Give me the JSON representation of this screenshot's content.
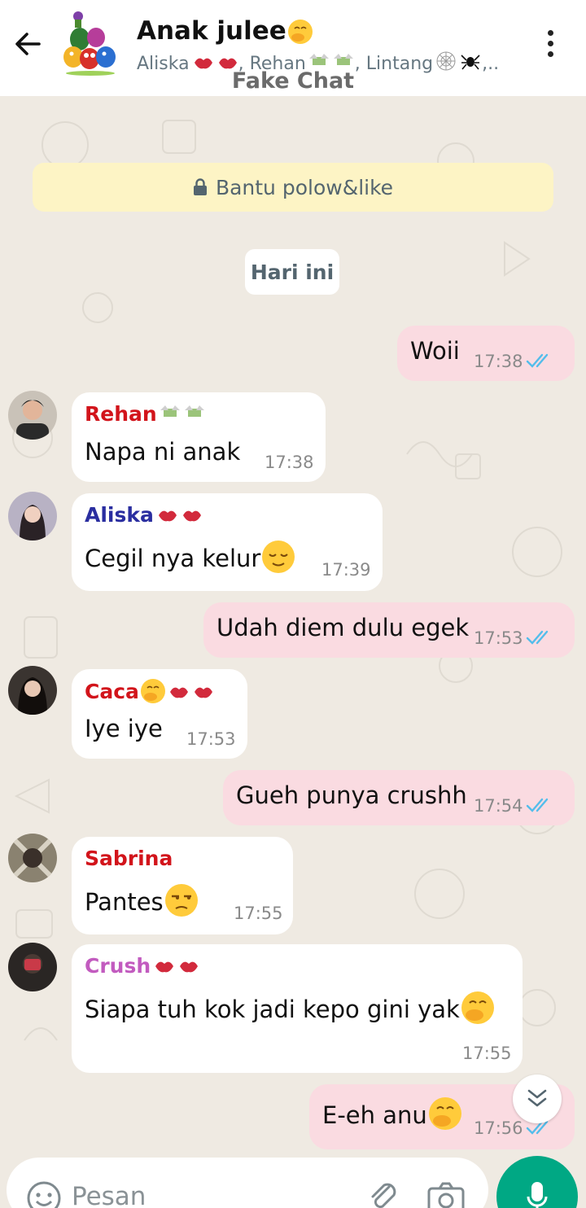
{
  "header": {
    "title": "Anak julee",
    "members": [
      "Aliska",
      "Rehan",
      "Lintang"
    ],
    "members_tail": ",..",
    "watermark": "Fake Chat"
  },
  "notice": {
    "text": "Bantu polow&like"
  },
  "date_chip": "Hari ini",
  "messages": [
    {
      "direction": "out",
      "text": "Woii",
      "time": "17:38",
      "status": "read"
    },
    {
      "direction": "in",
      "sender": "Rehan",
      "sender_color": "#d2141b",
      "text": "Napa ni anak",
      "time": "17:38"
    },
    {
      "direction": "in",
      "sender": "Aliska",
      "sender_color": "#2a2ea0",
      "text": "Cegil nya kelur",
      "time": "17:39"
    },
    {
      "direction": "out",
      "text": "Udah diem dulu egek",
      "time": "17:53",
      "status": "read"
    },
    {
      "direction": "in",
      "sender": "Caca",
      "sender_color": "#d2141b",
      "text": "Iye iye",
      "time": "17:53"
    },
    {
      "direction": "out",
      "text": "Gueh punya crushh",
      "time": "17:54",
      "status": "read"
    },
    {
      "direction": "in",
      "sender": "Sabrina",
      "sender_color": "#d2141b",
      "text": "Pantes",
      "time": "17:55"
    },
    {
      "direction": "in",
      "sender": "Crush",
      "sender_color": "#c25bbf",
      "text": "Siapa tuh kok jadi kepo gini yak",
      "time": "17:55"
    },
    {
      "direction": "out",
      "text": "E-eh anu",
      "time": "17:56",
      "status": "read"
    }
  ],
  "input": {
    "placeholder": "Pesan"
  },
  "colors": {
    "incoming_bubble": "#ffffff",
    "outgoing_bubble": "#fadbe1",
    "read_ticks": "#53bdeb",
    "send_button": "#00a884",
    "notice_bg": "#fdf4c5",
    "chat_bg": "#efeae2"
  },
  "icons": [
    "back-arrow-icon",
    "more-vert-icon",
    "lock-icon",
    "double-check-icon",
    "chevron-double-down-icon",
    "smiley-icon",
    "attach-icon",
    "camera-icon",
    "mic-icon"
  ]
}
